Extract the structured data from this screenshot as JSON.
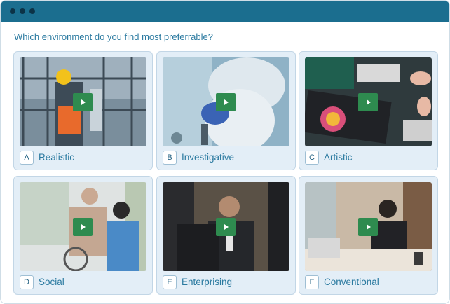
{
  "question": "Which environment do you find most preferrable?",
  "play_icon": "play-icon",
  "colors": {
    "titlebar": "#1b6e8f",
    "accent": "#2b7aa0",
    "card_bg": "#e3eef7",
    "play": "#2e8b4f"
  },
  "options": [
    {
      "letter": "A",
      "label": "Realistic"
    },
    {
      "letter": "B",
      "label": "Investigative"
    },
    {
      "letter": "C",
      "label": "Artistic"
    },
    {
      "letter": "D",
      "label": "Social"
    },
    {
      "letter": "E",
      "label": "Enterprising"
    },
    {
      "letter": "F",
      "label": "Conventional"
    }
  ]
}
